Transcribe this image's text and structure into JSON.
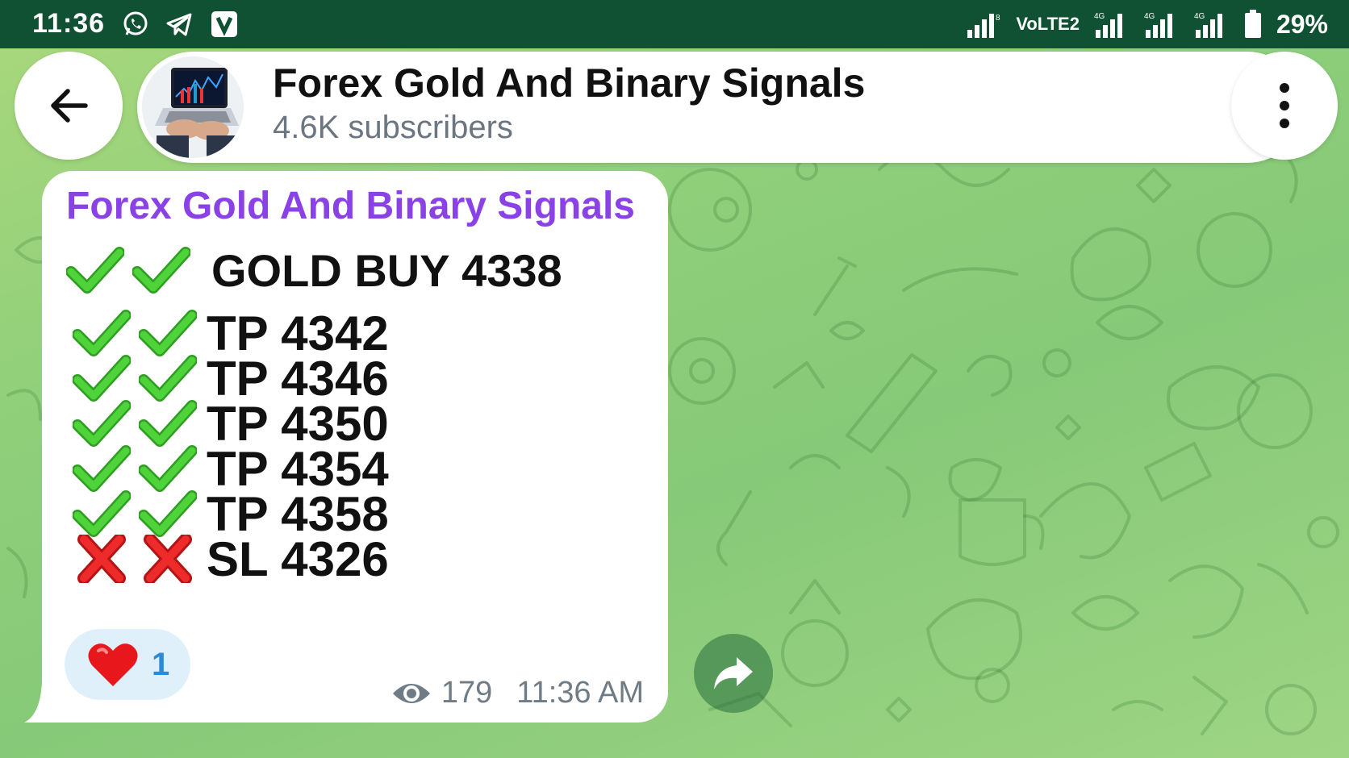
{
  "status_bar": {
    "time": "11:36",
    "app_icons": [
      "whatsapp-icon",
      "telegram-icon",
      "v-app-icon"
    ],
    "network_label": "VoLTE2",
    "network_type": "4G",
    "battery": "29%",
    "colors": {
      "background": "#0f5132"
    }
  },
  "header": {
    "channel_name": "Forex Gold And Binary Signals",
    "subscribers": "4.6K subscribers"
  },
  "message": {
    "sender": "Forex Gold And Binary Signals",
    "headline": "GOLD BUY 4338",
    "lines": [
      {
        "text": "TP 4342",
        "mark": "check"
      },
      {
        "text": "TP 4346",
        "mark": "check"
      },
      {
        "text": "TP 4350",
        "mark": "check"
      },
      {
        "text": "TP 4354",
        "mark": "check"
      },
      {
        "text": "TP 4358",
        "mark": "check"
      },
      {
        "text": "SL 4326",
        "mark": "cross"
      }
    ],
    "reaction": {
      "emoji": "heart",
      "count": "1"
    },
    "views": "179",
    "time": "11:36 AM"
  },
  "colors": {
    "sender_name": "#8a42e6",
    "check": "#3ec02c",
    "cross": "#e02020",
    "reaction_count": "#2b8ad8",
    "chat_background": "#8fcf7a"
  }
}
